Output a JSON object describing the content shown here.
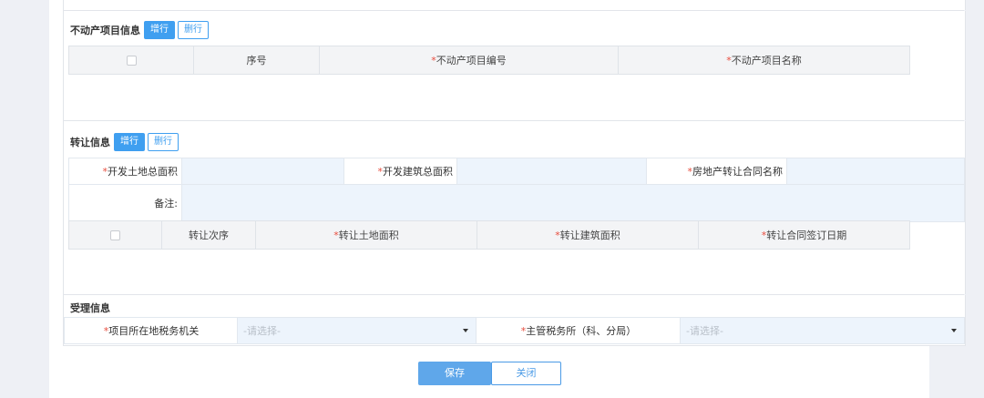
{
  "real_estate": {
    "title": "不动产项目信息",
    "add_label": "增行",
    "del_label": "删行",
    "columns": {
      "seq": "序号",
      "code_req": "*",
      "code": "不动产项目编号",
      "name_req": "*",
      "name": "不动产项目名称"
    }
  },
  "transfer": {
    "title": "转让信息",
    "add_label": "增行",
    "del_label": "删行",
    "fields": {
      "land_area_req": "*",
      "land_area": "开发土地总面积",
      "building_area_req": "*",
      "building_area": "开发建筑总面积",
      "contract_name_req": "*",
      "contract_name": "房地产转让合同名称",
      "remark": "备注:"
    },
    "columns": {
      "order": "转让次序",
      "land_req": "*",
      "land": "转让土地面积",
      "building_req": "*",
      "building": "转让建筑面积",
      "date_req": "*",
      "date": "转让合同签订日期"
    }
  },
  "acceptance": {
    "title": "受理信息",
    "tax_office_req": "*",
    "tax_office_label": "项目所在地税务机关",
    "tax_office_value": "-请选择-",
    "branch_req": "*",
    "branch_label": "主管税务所（科、分局）",
    "branch_value": "-请选择-"
  },
  "actions": {
    "save": "保存",
    "close": "关闭"
  }
}
